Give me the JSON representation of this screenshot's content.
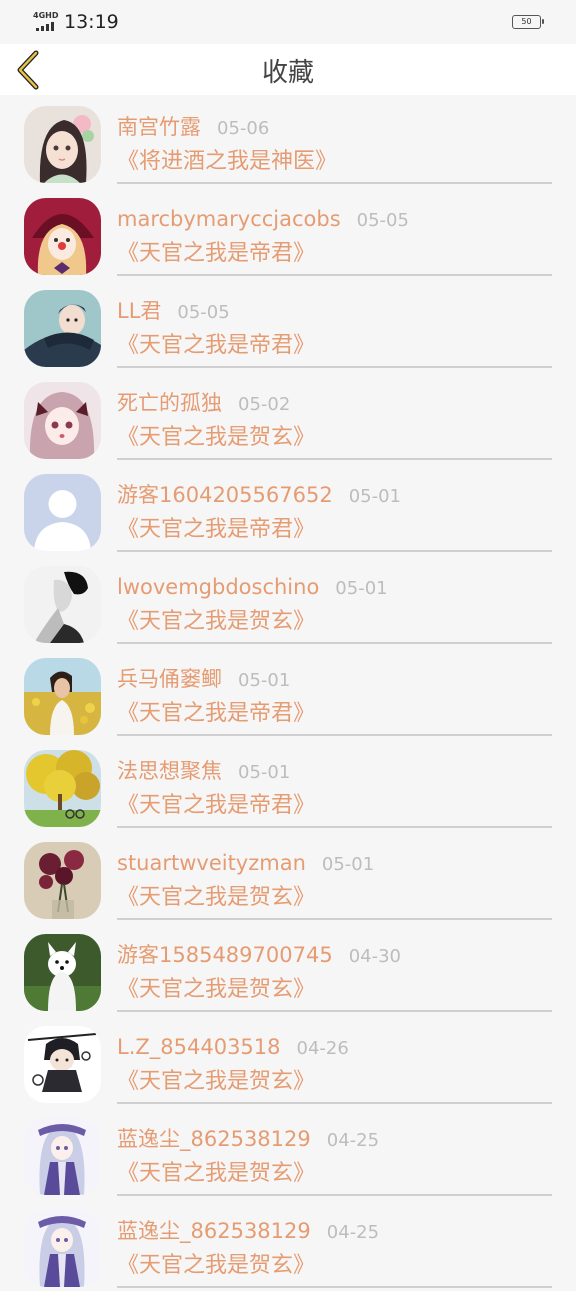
{
  "status_bar": {
    "network": "4GHD",
    "time": "13:19",
    "battery": "50"
  },
  "header": {
    "title": "收藏"
  },
  "items": [
    {
      "name": "南宫竹露",
      "date": "05-06",
      "book": "《将进酒之我是神医》",
      "avatar": "anime-girl-flowers"
    },
    {
      "name": "marcbymaryccjacobs",
      "date": "05-05",
      "book": "《天官之我是帝君》",
      "avatar": "clown-girl"
    },
    {
      "name": "LL君",
      "date": "05-05",
      "book": "《天官之我是帝君》",
      "avatar": "anime-boy-scarf"
    },
    {
      "name": "死亡的孤独",
      "date": "05-02",
      "book": "《天官之我是贺玄》",
      "avatar": "anime-girl-pink-hair"
    },
    {
      "name": "游客1604205567652",
      "date": "05-01",
      "book": "《天官之我是帝君》",
      "avatar": "default-user"
    },
    {
      "name": "lwovemgbdoschino",
      "date": "05-01",
      "book": "《天官之我是贺玄》",
      "avatar": "woman-profile-bw"
    },
    {
      "name": "兵马俑窭鲫",
      "date": "05-01",
      "book": "《天官之我是帝君》",
      "avatar": "girl-in-field"
    },
    {
      "name": "法思想聚焦",
      "date": "05-01",
      "book": "《天官之我是帝君》",
      "avatar": "yellow-tree"
    },
    {
      "name": "stuartwveityzman",
      "date": "05-01",
      "book": "《天官之我是贺玄》",
      "avatar": "red-flowers"
    },
    {
      "name": "游客1585489700745",
      "date": "04-30",
      "book": "《天官之我是贺玄》",
      "avatar": "white-dog"
    },
    {
      "name": "L.Z_854403518",
      "date": "04-26",
      "book": "《天官之我是贺玄》",
      "avatar": "chibi-character"
    },
    {
      "name": "蓝逸尘_862538129",
      "date": "04-25",
      "book": "《天官之我是贺玄》",
      "avatar": "anime-girl-silver"
    },
    {
      "name": "蓝逸尘_862538129",
      "date": "04-25",
      "book": "《天官之我是贺玄》",
      "avatar": "anime-girl-silver"
    }
  ]
}
